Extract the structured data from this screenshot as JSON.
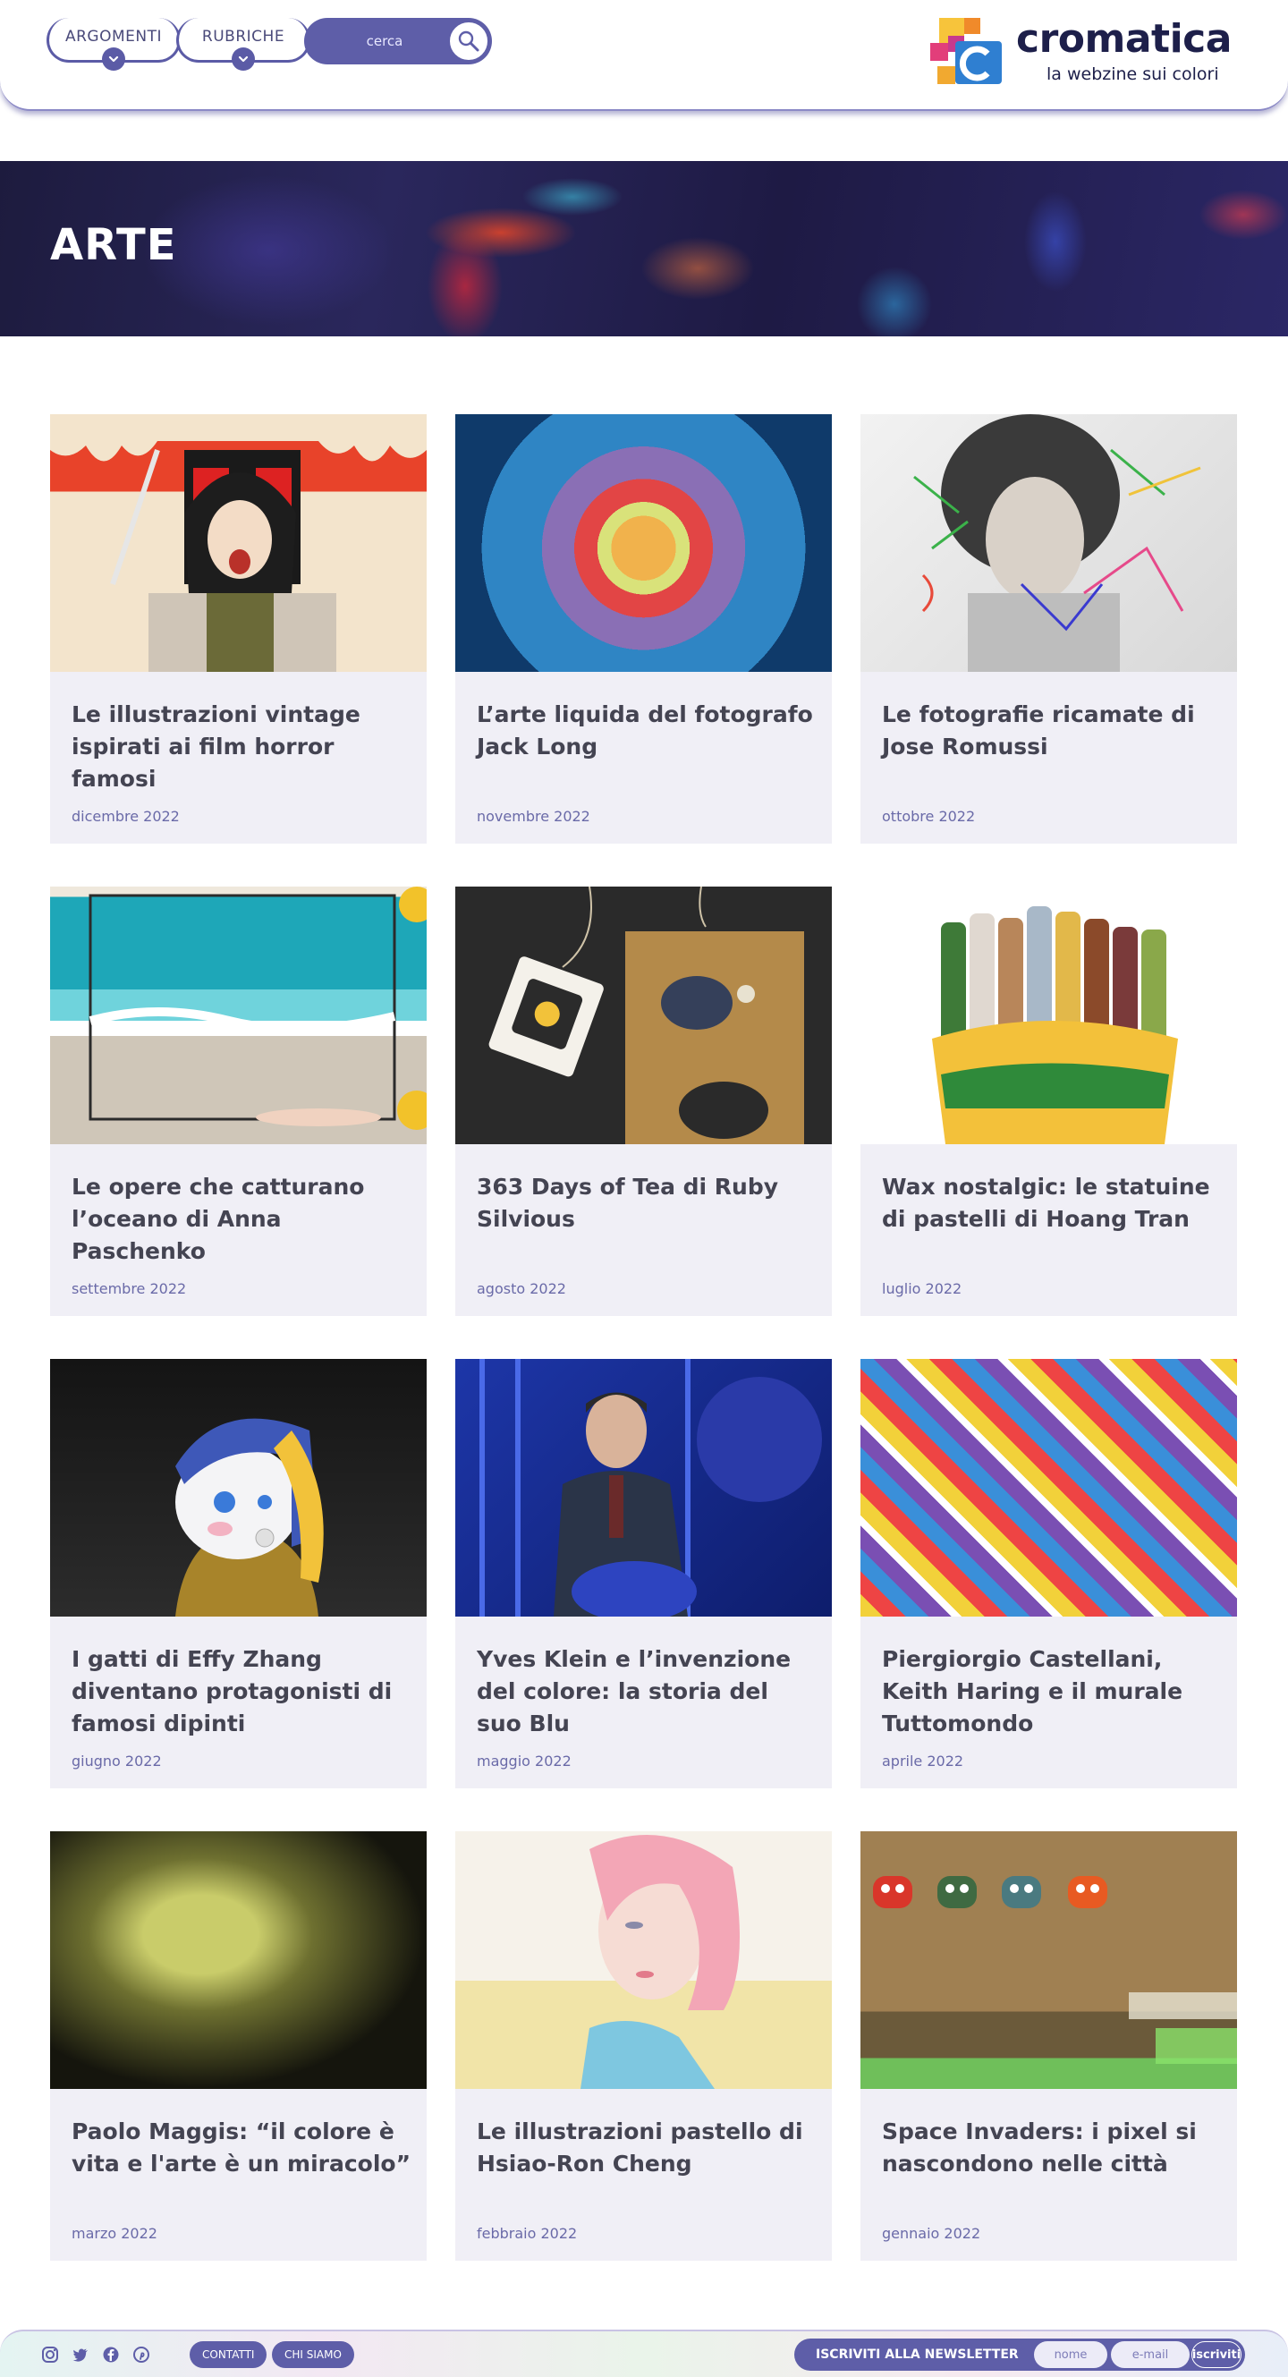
{
  "header": {
    "nav": {
      "argomenti_label": "ARGOMENTI",
      "rubriche_label": "RUBRICHE",
      "search_placeholder": "cerca"
    },
    "logo": {
      "name": "cromatica",
      "tagline": "la webzine sui colori"
    }
  },
  "hero": {
    "title": "ARTE"
  },
  "articles": [
    {
      "title": "Le illustrazioni vintage ispirati ai film horror famosi",
      "date": "dicembre 2022"
    },
    {
      "title": "L’arte liquida del fotografo Jack Long",
      "date": "novembre 2022"
    },
    {
      "title": "Le fotografie ricamate di Jose Romussi",
      "date": "ottobre 2022"
    },
    {
      "title": "Le opere che catturano l’oceano di Anna Paschenko",
      "date": "settembre 2022"
    },
    {
      "title": "363 Days of Tea di Ruby Silvious",
      "date": "agosto 2022"
    },
    {
      "title": "Wax nostalgic: le statuine di pastelli di Hoang Tran",
      "date": "luglio 2022"
    },
    {
      "title": "I gatti di Effy Zhang diventano protagonisti di famosi dipinti",
      "date": "giugno 2022"
    },
    {
      "title": "Yves Klein e l’invenzione del colore: la storia del suo Blu",
      "date": "maggio 2022"
    },
    {
      "title": "Piergiorgio Castellani, Keith Haring e il murale Tuttomondo",
      "date": "aprile 2022"
    },
    {
      "title": "Paolo Maggis: “il colore è vita e l'arte è un miracolo”",
      "date": "marzo 2022"
    },
    {
      "title": "Le illustrazioni pastello di Hsiao-Ron Cheng",
      "date": "febbraio 2022"
    },
    {
      "title": "Space Invaders: i pixel si nascondono nelle città",
      "date": "gennaio 2022"
    }
  ],
  "footer": {
    "contatti_label": "CONTATTI",
    "chi_siamo_label": "CHI SIAMO",
    "newsletter_label": "ISCRIVITI ALLA NEWSLETTER",
    "name_placeholder": "nome",
    "email_placeholder": "e-mail",
    "subscribe_label": "iscriviti"
  },
  "colors": {
    "accent": "#5e5ea8",
    "card_bg": "#f0eff6",
    "logo_text": "#1d1f4a"
  },
  "icons": {
    "social": [
      "instagram-icon",
      "twitter-icon",
      "facebook-icon",
      "pinterest-icon"
    ],
    "search": "magnifier-icon",
    "dropdown": "chevron-down-icon"
  }
}
